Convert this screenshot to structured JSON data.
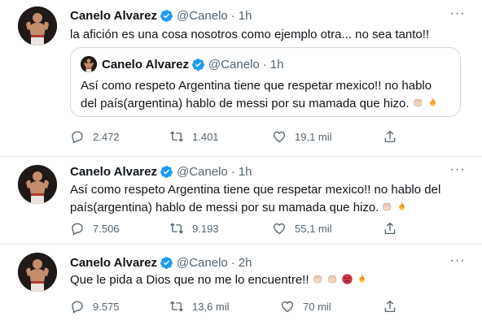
{
  "tweets": [
    {
      "name": "Canelo Alvarez",
      "handle": "@Canelo",
      "dot": "·",
      "time": "1h",
      "text": "la afición es una cosa nosotros como ejemplo otra... no sea tanto!!",
      "quote": {
        "name": "Canelo Alvarez",
        "handle": "@Canelo",
        "dot": "·",
        "time": "1h",
        "text": "Así como respeto Argentina tiene que respetar mexico!! no hablo del país(argentina) hablo de messi por su mamada que hizo."
      },
      "replies": "2.472",
      "retweets": "1.401",
      "likes": "19,1 mil"
    },
    {
      "name": "Canelo Alvarez",
      "handle": "@Canelo",
      "dot": "·",
      "time": "1h",
      "text": "Así como respeto Argentina tiene que respetar mexico!! no hablo del país(argentina) hablo de messi por su mamada que hizo.",
      "replies": "7.506",
      "retweets": "9.193",
      "likes": "55,1 mil"
    },
    {
      "name": "Canelo Alvarez",
      "handle": "@Canelo",
      "dot": "·",
      "time": "2h",
      "text": "Que le pida a Dios que no me lo encuentre!!",
      "replies": "9.575",
      "retweets": "13,6 mil",
      "likes": "70 mil"
    }
  ],
  "icons": {
    "verified": "verified-badge-icon",
    "reply": "reply-icon",
    "retweet": "retweet-icon",
    "like": "heart-icon",
    "share": "share-icon",
    "more": "more-icon",
    "fist": "fist-emoji",
    "fire": "fire-emoji",
    "angry": "angry-face-emoji"
  },
  "more_glyph": "···",
  "colors": {
    "verified": "#1d9bf0",
    "muted": "#536471",
    "border": "#e6ecf0"
  }
}
